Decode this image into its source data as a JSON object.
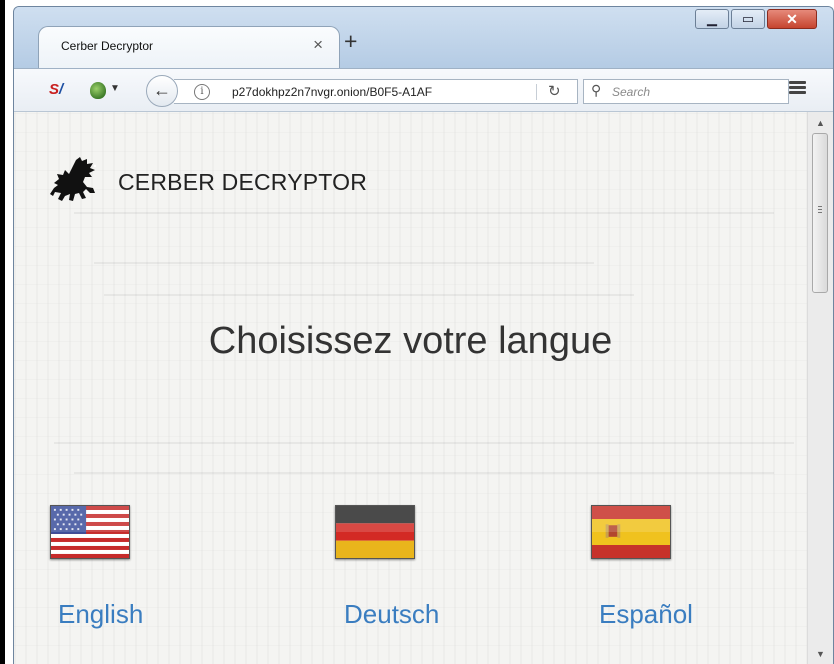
{
  "browser": {
    "tab_title": "Cerber Decryptor",
    "tab_close": "×",
    "new_tab": "+",
    "url": "p27dokhpz2n7nvgr.onion/B0F5-A1AF",
    "search_placeholder": "Search",
    "icons": [
      "addon-s-icon",
      "tor-onion-icon",
      "back-arrow-icon",
      "info-icon",
      "reload-icon",
      "search-icon",
      "hamburger-menu-icon",
      "minimize-icon",
      "maximize-icon",
      "close-icon"
    ]
  },
  "page": {
    "brand_title": "CERBER DECRYPTOR",
    "headline": "Choisissez votre langue",
    "languages": [
      {
        "label": "English",
        "flag": "us-flag-icon"
      },
      {
        "label": "Deutsch",
        "flag": "germany-flag-icon"
      },
      {
        "label": "Español",
        "flag": "spain-flag-icon"
      }
    ]
  },
  "colors": {
    "link": "#3a7dc0",
    "headline": "#333333",
    "close_button": "#c6442f"
  }
}
